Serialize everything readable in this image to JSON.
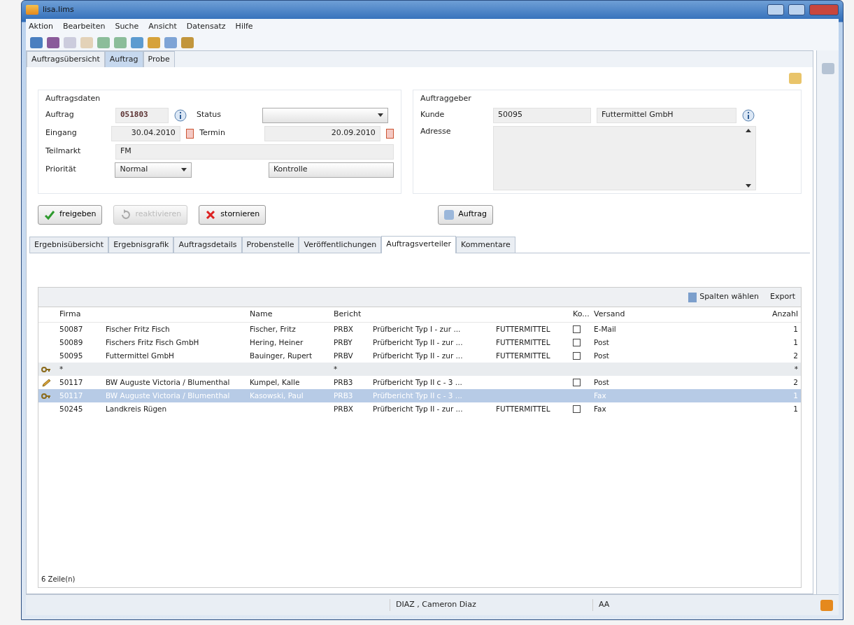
{
  "window": {
    "title": "lisa.lims"
  },
  "menu": [
    "Aktion",
    "Bearbeiten",
    "Suche",
    "Ansicht",
    "Datensatz",
    "Hilfe"
  ],
  "main_tabs": [
    {
      "label": "Auftragsübersicht",
      "selected": false
    },
    {
      "label": "Auftrag",
      "selected": true
    },
    {
      "label": "Probe",
      "selected": false
    }
  ],
  "auftragsdaten": {
    "title": "Auftragsdaten",
    "auftrag": {
      "label": "Auftrag",
      "value": "051803"
    },
    "status": {
      "label": "Status"
    },
    "eingang": {
      "label": "Eingang",
      "value": "30.04.2010"
    },
    "termin": {
      "label": "Termin",
      "value": "20.09.2010"
    },
    "teilmarkt": {
      "label": "Teilmarkt",
      "value": "FM"
    },
    "prioritaet": {
      "label": "Priorität",
      "value": "Normal"
    },
    "kontrolle": {
      "value": "Kontrolle"
    }
  },
  "auftraggeber": {
    "title": "Auftraggeber",
    "kunde_label": "Kunde",
    "kunde_nr": "50095",
    "kunde_name": "Futtermittel GmbH",
    "adresse_label": "Adresse"
  },
  "actions": [
    {
      "label": "freigeben",
      "kind": "check",
      "disabled": false
    },
    {
      "label": "reaktivieren",
      "kind": "reactivate",
      "disabled": true
    },
    {
      "label": "stornieren",
      "kind": "cross",
      "disabled": false
    }
  ],
  "auftrag_button": "Auftrag",
  "detail_tabs": [
    {
      "label": "Ergebnisübersicht",
      "selected": false
    },
    {
      "label": "Ergebnisgrafik",
      "selected": false
    },
    {
      "label": "Auftragsdetails",
      "selected": false
    },
    {
      "label": "Probenstelle",
      "selected": false
    },
    {
      "label": "Veröffentlichungen",
      "selected": false
    },
    {
      "label": "Auftragsverteiler",
      "selected": true
    },
    {
      "label": "Kommentare",
      "selected": false
    }
  ],
  "grid_toolbar": [
    "Spalten wählen",
    "Export"
  ],
  "table": {
    "columns": [
      "Firma",
      "",
      "Name",
      "Bericht",
      "",
      "",
      "Ko...",
      "Versand",
      "Anzahl"
    ],
    "rows": [
      {
        "kind": "normal",
        "selected": false,
        "cells": [
          "50087",
          "Fischer Fritz Fisch",
          "Fischer, Fritz",
          "PRBX",
          "Prüfbericht Typ I - zur ...",
          "FUTTERMITTEL",
          "",
          "E-Mail",
          "1"
        ],
        "ko": false
      },
      {
        "kind": "normal",
        "selected": false,
        "cells": [
          "50089",
          "Fischers Fritz Fisch GmbH",
          "Hering, Heiner",
          "PRBY",
          "Prüfbericht Typ II - zur ...",
          "FUTTERMITTEL",
          "",
          "Post",
          "1"
        ],
        "ko": false
      },
      {
        "kind": "normal",
        "selected": false,
        "cells": [
          "50095",
          "Futtermittel GmbH",
          "Bauinger, Rupert",
          "PRBV",
          "Prüfbericht Typ II - zur ...",
          "FUTTERMITTEL",
          "",
          "Post",
          "2"
        ],
        "ko": false
      },
      {
        "kind": "new",
        "selected": false,
        "cells": [
          "*",
          "",
          "",
          "*",
          "",
          "",
          "",
          "",
          "*"
        ]
      },
      {
        "kind": "edit",
        "selected": false,
        "cells": [
          "50117",
          "BW Auguste Victoria / Blumenthal",
          "Kumpel, Kalle",
          "PRB3",
          "Prüfbericht Typ II c - 3 ...",
          "",
          "",
          "Post",
          "2"
        ],
        "ko": false
      },
      {
        "kind": "new",
        "selected": true,
        "cells": [
          "50117",
          "BW Auguste Victoria / Blumenthal",
          "Kasowski, Paul",
          "PRB3",
          "Prüfbericht Typ II c - 3 ...",
          "",
          "",
          "Fax",
          "1"
        ]
      },
      {
        "kind": "normal",
        "selected": false,
        "cells": [
          "50245",
          "Landkreis Rügen",
          "",
          "PRBX",
          "Prüfbericht Typ II - zur ...",
          "FUTTERMITTEL",
          "",
          "Fax",
          "1"
        ],
        "ko": false
      }
    ]
  },
  "row_count": "6 Zeile(n)",
  "status_bar": {
    "user": "DIAZ , Cameron Diaz",
    "code": "AA"
  }
}
